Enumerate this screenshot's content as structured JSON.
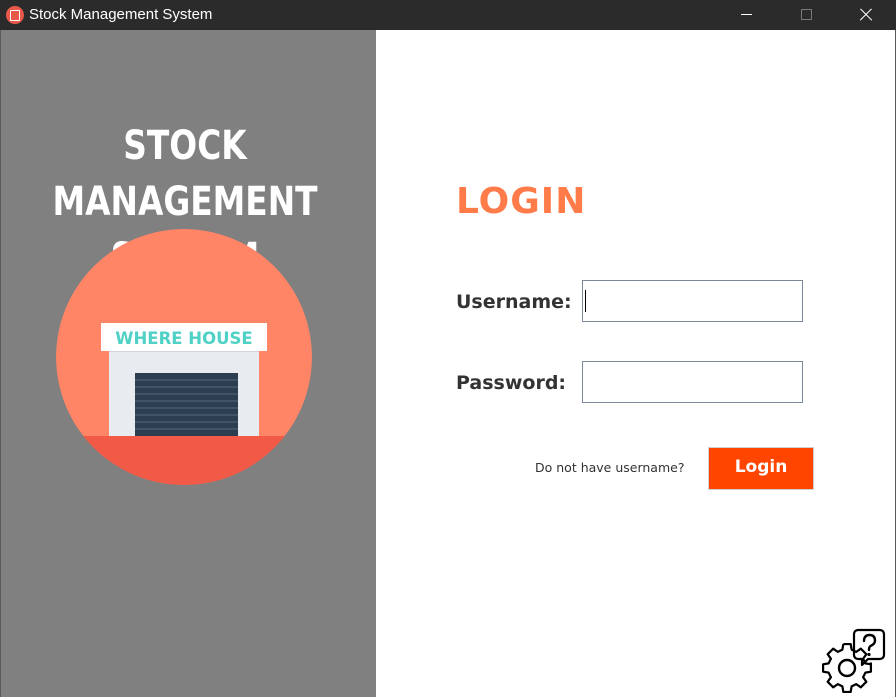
{
  "window": {
    "title": "Stock Management System",
    "icon": "app-icon"
  },
  "left_panel": {
    "title_line1": "STOCK MANAGEMENT",
    "title_line2": "SYSTEM",
    "illustration_sign": "WHERE HOUSE",
    "colors": {
      "background": "#808080",
      "circle": "#ff8566",
      "circle_base": "#f05a46",
      "sign_text": "#4fd1c5",
      "door": "#2c3e50"
    }
  },
  "login_form": {
    "heading": "LOGIN",
    "username_label": "Username:",
    "password_label": "Password:",
    "username_value": "",
    "password_value": "",
    "register_link": "Do not have username?",
    "login_button": "Login",
    "colors": {
      "heading": "#ff7b4a",
      "button": "#ff4500"
    }
  },
  "corner_icon": "help-settings-icon"
}
